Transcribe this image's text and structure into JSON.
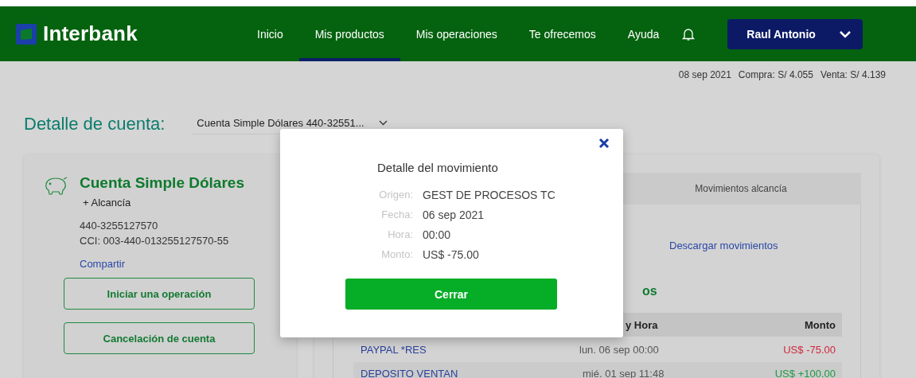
{
  "header": {
    "logo": "Interbank",
    "nav": [
      {
        "label": "Inicio",
        "selected": false
      },
      {
        "label": "Mis productos",
        "selected": true
      },
      {
        "label": "Mis operaciones",
        "selected": false
      },
      {
        "label": "Te ofrecemos",
        "selected": false
      },
      {
        "label": "Ayuda",
        "selected": false
      }
    ],
    "user": "Raul Antonio"
  },
  "rates": [
    "08 sep 2021",
    "Compra: S/ 4.055",
    "Venta: S/ 4.139"
  ],
  "page_title": "Detalle de cuenta:",
  "account_select": {
    "value": "Cuenta Simple Dólares 440-32551..."
  },
  "account_card": {
    "name": "Cuenta Simple Dólares",
    "subtitle": "+ Alcancía",
    "number": "440-3255127570",
    "cci": "CCI: 003-440-013255127570-55",
    "share_link": "Compartir",
    "buttons": [
      "Iniciar una operación",
      "Cancelación de cuenta"
    ]
  },
  "movements": {
    "tabs": [
      {
        "label": "Movimientos alcancía",
        "selected": false
      }
    ],
    "download_link": "Descargar movimientos",
    "heading": "os",
    "table": {
      "columns": [
        "y Hora",
        "Monto"
      ],
      "rows": [
        {
          "description": "PAYPAL *RES",
          "date": "lun. 06 sep 00:00",
          "amount": "US$ -75.00",
          "kind": "debit"
        },
        {
          "description": "DEPOSITO VENTAN",
          "date": "mié. 01 sep 11:48",
          "amount": "US$ +100.00",
          "kind": "credit"
        }
      ]
    }
  },
  "modal": {
    "title": "Detalle del movimiento",
    "fields": [
      {
        "label": "Origen:",
        "value": "GEST DE PROCESOS TC"
      },
      {
        "label": "Fecha:",
        "value": "06 sep 2021"
      },
      {
        "label": "Hora:",
        "value": "00:00"
      },
      {
        "label": "Monto:",
        "value": "US$ -75.00"
      }
    ],
    "button": "Cerrar"
  }
}
